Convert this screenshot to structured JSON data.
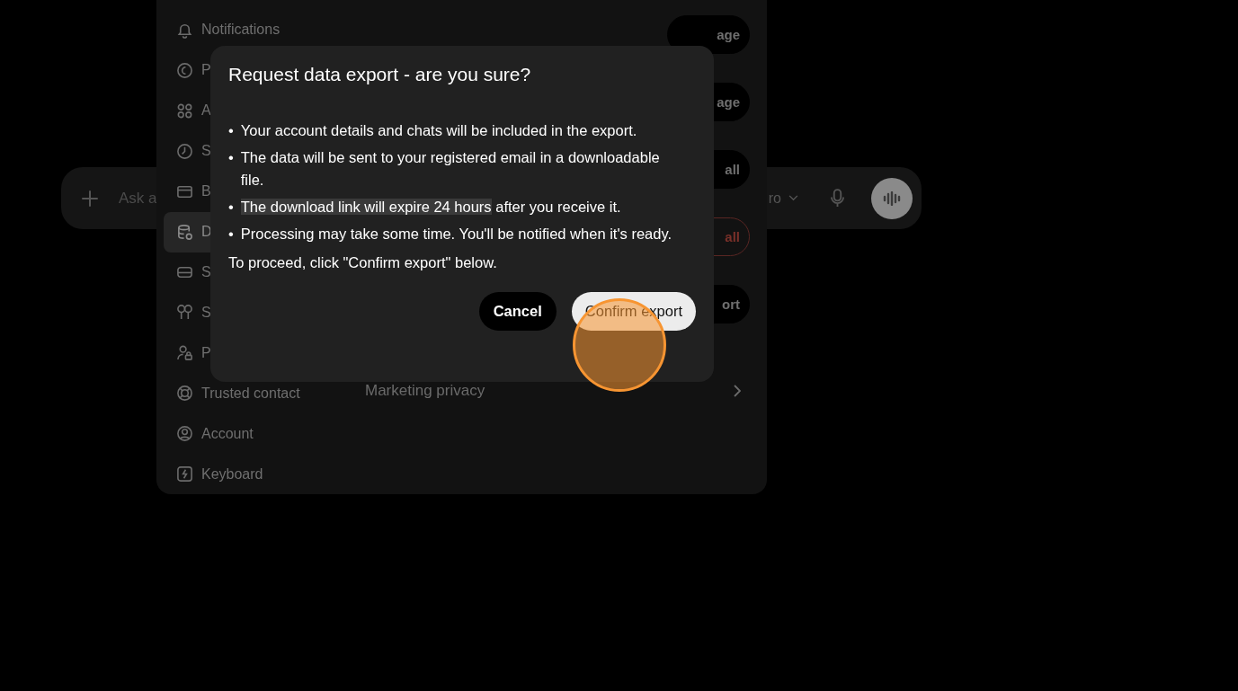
{
  "chat_bar": {
    "placeholder": "Ask a",
    "model": "ro"
  },
  "settings_sidebar": [
    {
      "label": "Notifications",
      "selected": false
    },
    {
      "label": "P",
      "selected": false
    },
    {
      "label": "A",
      "selected": false
    },
    {
      "label": "S",
      "selected": false
    },
    {
      "label": "B",
      "selected": false
    },
    {
      "label": "D",
      "selected": true
    },
    {
      "label": "S",
      "selected": false
    },
    {
      "label": "S",
      "selected": false
    },
    {
      "label": "P",
      "selected": false
    },
    {
      "label": "Trusted contact",
      "selected": false
    },
    {
      "label": "Account",
      "selected": false
    },
    {
      "label": "Keyboard",
      "selected": false
    }
  ],
  "settings_buttons": [
    {
      "label": "age",
      "kind": "normal"
    },
    {
      "label": "age",
      "kind": "normal"
    },
    {
      "label": "all",
      "kind": "normal"
    },
    {
      "label": "all",
      "kind": "danger"
    },
    {
      "label": "ort",
      "kind": "normal"
    }
  ],
  "marketing_row": {
    "label": "Marketing privacy"
  },
  "dialog": {
    "title": "Request data export - are you sure?",
    "bullets": [
      {
        "marker": "•",
        "text": "Your account details and chats will be included in the export."
      },
      {
        "marker": "•",
        "text": "The data will be sent to your registered email in a downloadable file."
      },
      {
        "marker": "•",
        "highlighted": "The download link will expire 24 hours",
        "text": "after you receive it."
      },
      {
        "marker": "•",
        "text": "Processing may take some time. You'll be notified when it's ready."
      }
    ],
    "note": "To proceed, click \"Confirm export\" below.",
    "cancel": "Cancel",
    "confirm": "Confirm export"
  }
}
